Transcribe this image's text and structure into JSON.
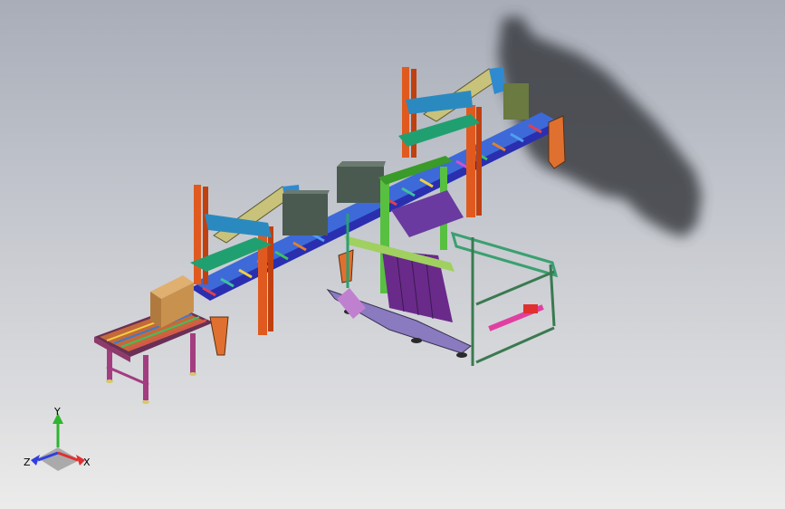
{
  "viewport": {
    "background_top": "#a8adb8",
    "background_bottom": "#e6e5e4"
  },
  "triad": {
    "x_label": "X",
    "y_label": "Y",
    "z_label": "Z",
    "x_color": "#e03030",
    "y_color": "#2fb52f",
    "z_color": "#2f3fe0"
  },
  "model": {
    "shadow_icon": "shadow-shape",
    "parts": [
      "conveyor-left-feed",
      "conveyor-main-line",
      "robot-arm-left",
      "robot-arm-right",
      "frame-cell-center",
      "cart-frame-right",
      "carton-box"
    ]
  }
}
